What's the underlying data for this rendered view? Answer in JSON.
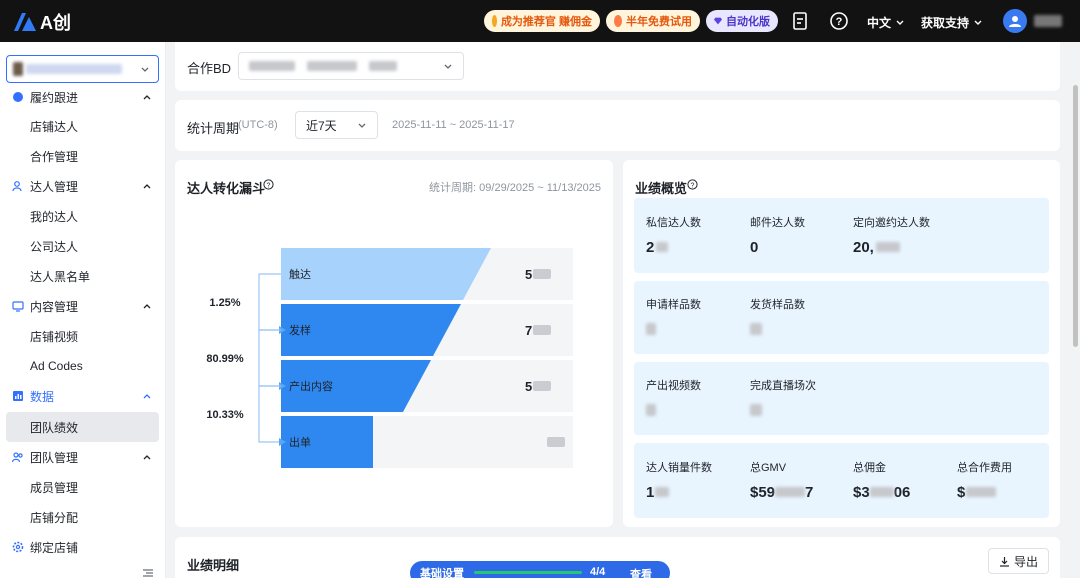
{
  "topbar": {
    "logo_text": "A创",
    "promo_1": "成为推荐官 赚佣金",
    "promo_2": "半年免费试用",
    "promo_3": "自动化版",
    "language": "中文",
    "support": "获取支持"
  },
  "sidebar": {
    "groups": [
      {
        "label": "履约跟进",
        "items": [
          "店铺达人",
          "合作管理"
        ]
      },
      {
        "label": "达人管理",
        "items": [
          "我的达人",
          "公司达人",
          "达人黑名单"
        ]
      },
      {
        "label": "内容管理",
        "items": [
          "店铺视频",
          "Ad Codes"
        ]
      },
      {
        "label": "数据",
        "items": [
          "团队绩效"
        ]
      },
      {
        "label": "团队管理",
        "items": [
          "成员管理",
          "店铺分配"
        ]
      },
      {
        "label": "绑定店铺",
        "items": []
      }
    ]
  },
  "filters": {
    "bd_label": "合作BD",
    "period_label": "统计周期",
    "timezone": "(UTC-8)",
    "period_value": "近7天",
    "date_range": "2025-11-11 ~ 2025-11-17"
  },
  "funnel": {
    "title": "达人转化漏斗",
    "period_text": "统计周期: 09/29/2025 ~ 11/13/2025",
    "stages": [
      "触达",
      "发样",
      "产出内容",
      "出单"
    ],
    "stage_values_visible": [
      "5",
      "7",
      "5",
      ""
    ],
    "rates": [
      "1.25%",
      "80.99%",
      "10.33%"
    ]
  },
  "overview": {
    "title": "业绩概览",
    "rows": [
      [
        {
          "label": "私信达人数",
          "value": "2"
        },
        {
          "label": "邮件达人数",
          "value": "0"
        },
        {
          "label": "定向邀约达人数",
          "value": "20,"
        }
      ],
      [
        {
          "label": "申请样品数",
          "value": ""
        },
        {
          "label": "发货样品数",
          "value": ""
        }
      ],
      [
        {
          "label": "产出视频数",
          "value": ""
        },
        {
          "label": "完成直播场次",
          "value": ""
        }
      ],
      [
        {
          "label": "达人销量件数",
          "value": "1"
        },
        {
          "label": "总GMV",
          "value": "$59"
        },
        {
          "label": "总佣金",
          "value": "$3"
        },
        {
          "label": "总合作费用",
          "value": "$"
        }
      ]
    ],
    "gmv_suffix": "7",
    "commission_suffix": "06"
  },
  "details": {
    "title": "业绩明细",
    "export_label": "导出"
  },
  "setup": {
    "label": "基础设置",
    "progress_text": "4/4",
    "progress_fraction": 1.0,
    "view_label": "查看"
  },
  "colors": {
    "accent": "#3370ff",
    "funnel_top": "#a6d2fb",
    "funnel_mid": "#2f88f0",
    "kpi_bg": "#e8f4fe"
  }
}
